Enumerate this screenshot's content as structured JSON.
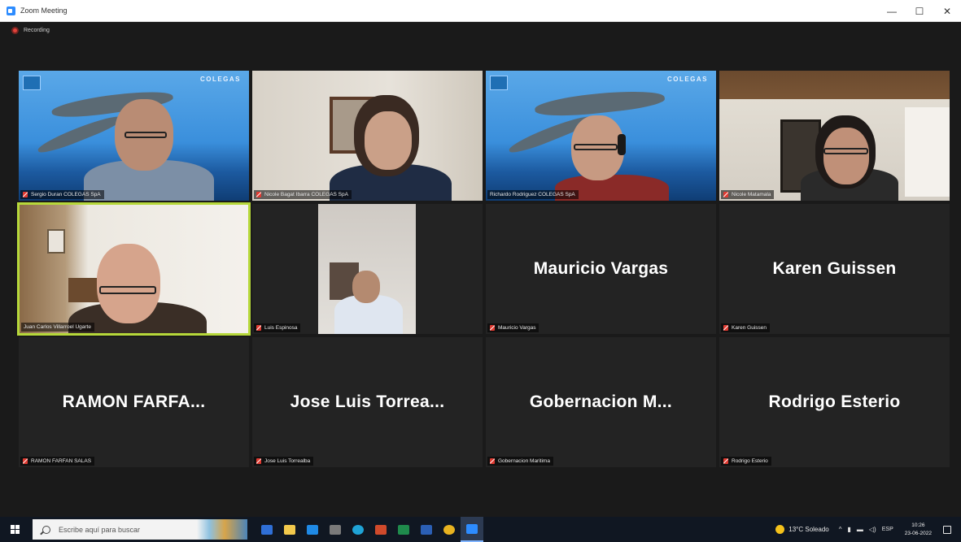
{
  "window": {
    "title": "Zoom Meeting",
    "controls": {
      "minimize": "—",
      "maximize": "☐",
      "close": "✕"
    }
  },
  "recording": {
    "label": "Recording"
  },
  "brand_text": "COLEGAS",
  "participants": [
    {
      "label": "Sergio Duran COLEGAS SpA",
      "has_video": true,
      "scene": "ocean",
      "muted": true
    },
    {
      "label": "Nicole Bagat Ibarra COLEGAS SpA",
      "has_video": true,
      "scene": "wall",
      "muted": true
    },
    {
      "label": "Richardo Rodriguez COLEGAS SpA",
      "has_video": true,
      "scene": "ocean",
      "muted": false
    },
    {
      "label": "Nicole Matamala",
      "has_video": true,
      "scene": "room",
      "muted": true
    },
    {
      "label": "Juan Carlos Villarroel Ugarte",
      "has_video": true,
      "scene": "office",
      "muted": false,
      "active_speaker": true
    },
    {
      "label": "Luis Espinosa",
      "has_video": true,
      "scene": "cam",
      "muted": true
    },
    {
      "display_name": "Mauricio Vargas",
      "label": "Mauricio Vargas",
      "has_video": false,
      "muted": true
    },
    {
      "display_name": "Karen Guissen",
      "label": "Karen Guissen",
      "has_video": false,
      "muted": true
    },
    {
      "display_name": "RAMON  FARFA...",
      "label": "RAMON FARFAN SALAS",
      "has_video": false,
      "muted": true
    },
    {
      "display_name": "Jose  Luis  Torrea...",
      "label": "Jose Luis Torrealba",
      "has_video": false,
      "muted": true
    },
    {
      "display_name": "Gobernacion  M...",
      "label": "Gobernacion Maritima",
      "has_video": false,
      "muted": true
    },
    {
      "display_name": "Rodrigo Esterio",
      "label": "Rodrigo Esterio",
      "has_video": false,
      "muted": true
    }
  ],
  "taskbar": {
    "search_placeholder": "Escribe aquí para buscar",
    "weather": "13°C Soleado",
    "language": "ESP",
    "time": "10:26",
    "date": "23-06-2022",
    "apps": [
      "task-view",
      "file-explorer",
      "mail",
      "store",
      "edge",
      "powerpoint",
      "excel",
      "word",
      "chrome",
      "zoom"
    ],
    "app_colors": [
      "#2f6fd6",
      "#f2c94c",
      "#1f8ae6",
      "#7a7a7a",
      "#1fa3d6",
      "#d04a2b",
      "#1f8b4c",
      "#2b5fb4",
      "#e8b320",
      "#2d8cff"
    ]
  },
  "colors": {
    "active_speaker_border": "#b6d83a",
    "muted_icon": "#e03b32",
    "accent": "#2d8cff"
  }
}
